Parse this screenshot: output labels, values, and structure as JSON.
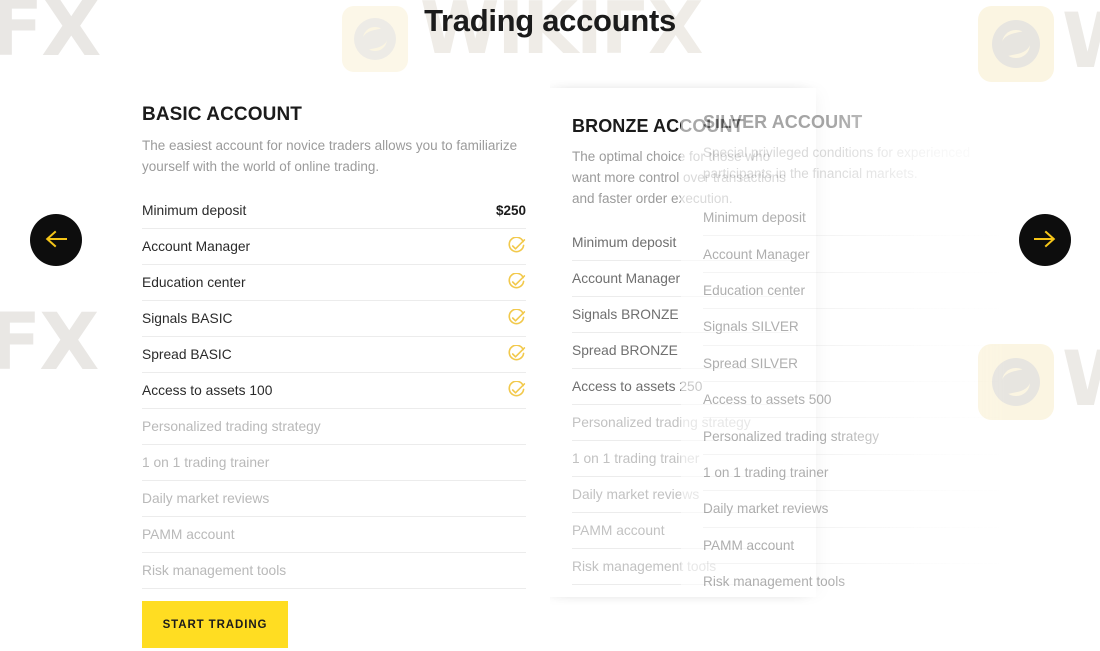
{
  "page": {
    "title": "Trading accounts",
    "accent_yellow": "#ffdd22",
    "check_color": "#f2c94c",
    "nav_bg": "#0d0d0d"
  },
  "watermarks": {
    "text_1": "FX",
    "text_2": "FX",
    "text_3": "WIKIFX",
    "text_4": "WIKIFX",
    "letter_1": "W",
    "letter_2": "W",
    "logo_icon": "wikifx-logo-icon"
  },
  "nav": {
    "prev_label": "prev-arrow-icon",
    "next_label": "next-arrow-icon"
  },
  "cta": {
    "label": "START TRADING"
  },
  "cards": [
    {
      "id": "basic",
      "title": "BASIC ACCOUNT",
      "description": "The easiest account for novice traders allows you to familiarize yourself with the world of online trading.",
      "features": [
        {
          "label": "Minimum deposit",
          "value": "$250",
          "enabled": true,
          "check": false
        },
        {
          "label": "Account Manager",
          "value": "",
          "enabled": true,
          "check": true
        },
        {
          "label": "Education center",
          "value": "",
          "enabled": true,
          "check": true
        },
        {
          "label": "Signals BASIC",
          "value": "",
          "enabled": true,
          "check": true
        },
        {
          "label": "Spread BASIC",
          "value": "",
          "enabled": true,
          "check": true
        },
        {
          "label": "Access to assets 100",
          "value": "",
          "enabled": true,
          "check": true
        },
        {
          "label": "Personalized trading strategy",
          "value": "",
          "enabled": false,
          "check": false
        },
        {
          "label": "1 on 1 trading trainer",
          "value": "",
          "enabled": false,
          "check": false
        },
        {
          "label": "Daily market reviews",
          "value": "",
          "enabled": false,
          "check": false
        },
        {
          "label": "PAMM account",
          "value": "",
          "enabled": false,
          "check": false
        },
        {
          "label": "Risk management tools",
          "value": "",
          "enabled": false,
          "check": false
        }
      ]
    },
    {
      "id": "bronze",
      "title": "BRONZE ACCOUNT",
      "description": "The optimal choice for those who want more control over transactions and faster order execution.",
      "features": [
        {
          "label": "Minimum deposit",
          "value": "",
          "enabled": true,
          "check": false
        },
        {
          "label": "Account Manager",
          "value": "",
          "enabled": true,
          "check": false
        },
        {
          "label": "Signals BRONZE",
          "value": "",
          "enabled": true,
          "check": false
        },
        {
          "label": "Spread BRONZE",
          "value": "",
          "enabled": true,
          "check": false
        },
        {
          "label": "Access to assets 250",
          "value": "",
          "enabled": true,
          "check": false
        },
        {
          "label": "Personalized trading strategy",
          "value": "",
          "enabled": false,
          "check": false
        },
        {
          "label": "1 on 1 trading trainer",
          "value": "",
          "enabled": false,
          "check": false
        },
        {
          "label": "Daily market reviews",
          "value": "",
          "enabled": false,
          "check": false
        },
        {
          "label": "PAMM account",
          "value": "",
          "enabled": false,
          "check": false
        },
        {
          "label": "Risk management tools",
          "value": "",
          "enabled": false,
          "check": false
        }
      ]
    },
    {
      "id": "silver",
      "title": "SILVER ACCOUNT",
      "description": "Special privileged conditions for experienced participants in the financial markets.",
      "features": [
        {
          "label": "Minimum deposit",
          "value": "",
          "enabled": true,
          "check": false
        },
        {
          "label": "Account Manager",
          "value": "",
          "enabled": true,
          "check": false
        },
        {
          "label": "Education center",
          "value": "",
          "enabled": true,
          "check": false
        },
        {
          "label": "Signals SILVER",
          "value": "",
          "enabled": true,
          "check": false
        },
        {
          "label": "Spread SILVER",
          "value": "",
          "enabled": true,
          "check": false
        },
        {
          "label": "Access to assets 500",
          "value": "",
          "enabled": true,
          "check": false
        },
        {
          "label": "Personalized trading strategy",
          "value": "",
          "enabled": true,
          "check": false
        },
        {
          "label": "1 on 1 trading trainer",
          "value": "",
          "enabled": true,
          "check": false
        },
        {
          "label": "Daily market reviews",
          "value": "",
          "enabled": true,
          "check": false
        },
        {
          "label": "PAMM account",
          "value": "",
          "enabled": true,
          "check": false
        },
        {
          "label": "Risk management tools",
          "value": "",
          "enabled": true,
          "check": false
        }
      ]
    }
  ]
}
